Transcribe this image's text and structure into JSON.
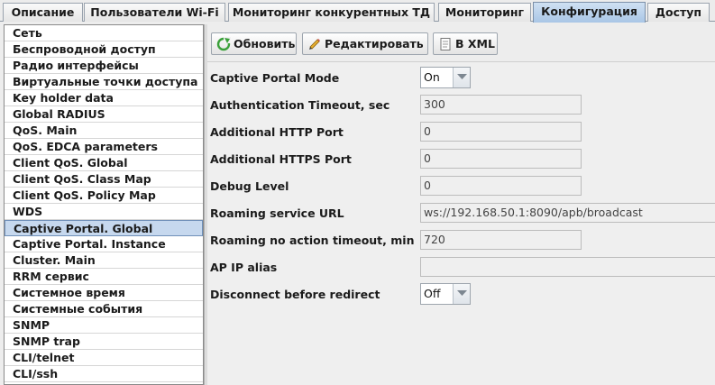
{
  "tabs": [
    {
      "label": "Описание"
    },
    {
      "label": "Пользователи Wi-Fi"
    },
    {
      "label": "Мониторинг конкурентных ТД"
    },
    {
      "label": "Мониторинг"
    },
    {
      "label": "Конфигурация",
      "active": true
    },
    {
      "label": "Доступ"
    }
  ],
  "sidebar": {
    "items": [
      {
        "label": "Сеть"
      },
      {
        "label": "Беспроводной доступ"
      },
      {
        "label": "Радио интерфейсы"
      },
      {
        "label": "Виртуальные точки доступа"
      },
      {
        "label": "Key holder data"
      },
      {
        "label": "Global RADIUS"
      },
      {
        "label": "QoS. Main"
      },
      {
        "label": "QoS. EDCA parameters"
      },
      {
        "label": "Client QoS. Global"
      },
      {
        "label": "Client QoS. Class Map"
      },
      {
        "label": "Client QoS. Policy Map"
      },
      {
        "label": "WDS"
      },
      {
        "label": "Captive Portal. Global",
        "selected": true
      },
      {
        "label": "Captive Portal. Instance"
      },
      {
        "label": "Cluster. Main"
      },
      {
        "label": "RRM сервис"
      },
      {
        "label": "Системное время"
      },
      {
        "label": "Системные события"
      },
      {
        "label": "SNMP"
      },
      {
        "label": "SNMP trap"
      },
      {
        "label": "CLI/telnet"
      },
      {
        "label": "CLI/ssh"
      }
    ]
  },
  "toolbar": {
    "refresh_label": "Обновить",
    "edit_label": "Редактировать",
    "xml_label": "В XML"
  },
  "form": {
    "captive_portal_mode": {
      "label": "Captive Portal Mode",
      "value": "On"
    },
    "auth_timeout": {
      "label": "Authentication Timeout, sec",
      "value": "300"
    },
    "http_port": {
      "label": "Additional HTTP Port",
      "value": "0"
    },
    "https_port": {
      "label": "Additional HTTPS Port",
      "value": "0"
    },
    "debug_level": {
      "label": "Debug Level",
      "value": "0"
    },
    "roaming_url": {
      "label": "Roaming service URL",
      "value": "ws://192.168.50.1:8090/apb/broadcast"
    },
    "roaming_timeout": {
      "label": "Roaming no action timeout, min",
      "value": "720"
    },
    "ap_ip_alias": {
      "label": "AP IP alias",
      "value": ""
    },
    "disconnect_before_redirect": {
      "label": "Disconnect before redirect",
      "value": "Off"
    }
  },
  "colors": {
    "active_tab": "#a9c6e6",
    "selected_item": "#c6d8ee",
    "refresh_icon": "#3aa03a",
    "edit_icon": "#e0a020"
  }
}
